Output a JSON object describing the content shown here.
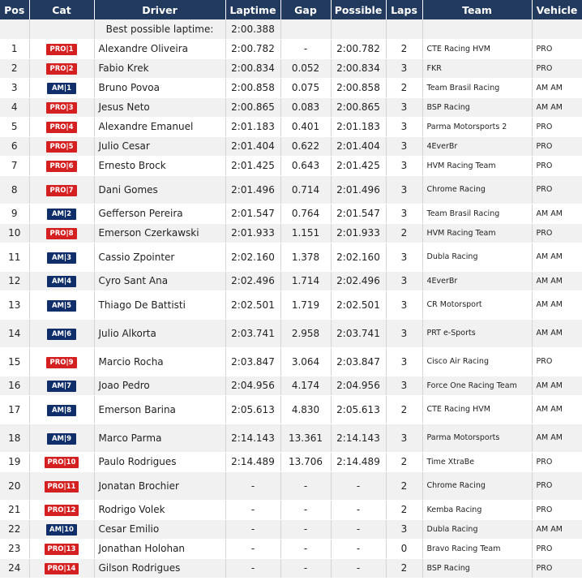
{
  "headers": [
    "Pos",
    "Cat",
    "Driver",
    "Laptime",
    "Gap",
    "Possible",
    "Laps",
    "Team",
    "Vehicle"
  ],
  "best": {
    "label": "Best possible laptime:",
    "value": "2:00.388"
  },
  "rows": [
    {
      "pos": "1",
      "cat": "PRO|1",
      "cls": "pro",
      "driver": "Alexandre Oliveira",
      "lap": "2:00.782",
      "gap": "-",
      "possible": "2:00.782",
      "laps": "2",
      "team": "CTE Racing HVM",
      "vehicle": "PRO"
    },
    {
      "pos": "2",
      "cat": "PRO|2",
      "cls": "pro",
      "driver": "Fabio Krek",
      "lap": "2:00.834",
      "gap": "0.052",
      "possible": "2:00.834",
      "laps": "3",
      "team": "FKR",
      "vehicle": "PRO"
    },
    {
      "pos": "3",
      "cat": "AM|1",
      "cls": "am",
      "driver": "Bruno Povoa",
      "lap": "2:00.858",
      "gap": "0.075",
      "possible": "2:00.858",
      "laps": "2",
      "team": "Team Brasil Racing",
      "vehicle": "AM AM"
    },
    {
      "pos": "4",
      "cat": "PRO|3",
      "cls": "pro",
      "driver": "Jesus Neto",
      "lap": "2:00.865",
      "gap": "0.083",
      "possible": "2:00.865",
      "laps": "3",
      "team": "BSP Racing",
      "vehicle": "AM AM"
    },
    {
      "pos": "5",
      "cat": "PRO|4",
      "cls": "pro",
      "driver": "Alexandre Emanuel",
      "lap": "2:01.183",
      "gap": "0.401",
      "possible": "2:01.183",
      "laps": "3",
      "team": "Parma Motorsports 2",
      "vehicle": "PRO"
    },
    {
      "pos": "6",
      "cat": "PRO|5",
      "cls": "pro",
      "driver": "Julio Cesar",
      "lap": "2:01.404",
      "gap": "0.622",
      "possible": "2:01.404",
      "laps": "3",
      "team": "4EverBr",
      "vehicle": "PRO"
    },
    {
      "pos": "7",
      "cat": "PRO|6",
      "cls": "pro",
      "driver": "Ernesto Brock",
      "lap": "2:01.425",
      "gap": "0.643",
      "possible": "2:01.425",
      "laps": "3",
      "team": "HVM Racing Team",
      "vehicle": "PRO"
    },
    {
      "pos": "8",
      "cat": "PRO|7",
      "cls": "pro",
      "driver": "Dani Gomes",
      "lap": "2:01.496",
      "gap": "0.714",
      "possible": "2:01.496",
      "laps": "3",
      "team": "Chrome Racing",
      "vehicle": "PRO"
    },
    {
      "pos": "9",
      "cat": "AM|2",
      "cls": "am",
      "driver": "Gefferson Pereira",
      "lap": "2:01.547",
      "gap": "0.764",
      "possible": "2:01.547",
      "laps": "3",
      "team": "Team Brasil Racing",
      "vehicle": "AM AM"
    },
    {
      "pos": "10",
      "cat": "PRO|8",
      "cls": "pro",
      "driver": "Emerson Czerkawski",
      "lap": "2:01.933",
      "gap": "1.151",
      "possible": "2:01.933",
      "laps": "2",
      "team": "HVM Racing Team",
      "vehicle": "PRO"
    },
    {
      "pos": "11",
      "cat": "AM|3",
      "cls": "am",
      "driver": "Cassio Zpointer",
      "lap": "2:02.160",
      "gap": "1.378",
      "possible": "2:02.160",
      "laps": "3",
      "team": "Dubla Racing",
      "vehicle": "AM AM"
    },
    {
      "pos": "12",
      "cat": "AM|4",
      "cls": "am",
      "driver": "Cyro Sant Ana",
      "lap": "2:02.496",
      "gap": "1.714",
      "possible": "2:02.496",
      "laps": "3",
      "team": "4EverBr",
      "vehicle": "AM AM"
    },
    {
      "pos": "13",
      "cat": "AM|5",
      "cls": "am",
      "driver": "Thiago De Battisti",
      "lap": "2:02.501",
      "gap": "1.719",
      "possible": "2:02.501",
      "laps": "3",
      "team": "CR Motorsport",
      "vehicle": "AM AM"
    },
    {
      "pos": "14",
      "cat": "AM|6",
      "cls": "am",
      "driver": "Julio Alkorta",
      "lap": "2:03.741",
      "gap": "2.958",
      "possible": "2:03.741",
      "laps": "3",
      "team": "PRT e-Sports",
      "vehicle": "AM AM"
    },
    {
      "pos": "15",
      "cat": "PRO|9",
      "cls": "pro",
      "driver": "Marcio Rocha",
      "lap": "2:03.847",
      "gap": "3.064",
      "possible": "2:03.847",
      "laps": "3",
      "team": "Cisco Air Racing",
      "vehicle": "PRO"
    },
    {
      "pos": "16",
      "cat": "AM|7",
      "cls": "am",
      "driver": "Joao Pedro",
      "lap": "2:04.956",
      "gap": "4.174",
      "possible": "2:04.956",
      "laps": "3",
      "team": "Force One Racing Team",
      "vehicle": "AM AM"
    },
    {
      "pos": "17",
      "cat": "AM|8",
      "cls": "am",
      "driver": "Emerson Barina",
      "lap": "2:05.613",
      "gap": "4.830",
      "possible": "2:05.613",
      "laps": "2",
      "team": "CTE Racing HVM",
      "vehicle": "AM AM"
    },
    {
      "pos": "18",
      "cat": "AM|9",
      "cls": "am",
      "driver": "Marco Parma",
      "lap": "2:14.143",
      "gap": "13.361",
      "possible": "2:14.143",
      "laps": "3",
      "team": "Parma Motorsports",
      "vehicle": "AM AM"
    },
    {
      "pos": "19",
      "cat": "PRO|10",
      "cls": "pro",
      "driver": "Paulo Rodrigues",
      "lap": "2:14.489",
      "gap": "13.706",
      "possible": "2:14.489",
      "laps": "2",
      "team": "Time XtraBe",
      "vehicle": "PRO"
    },
    {
      "pos": "20",
      "cat": "PRO|11",
      "cls": "pro",
      "driver": "Jonatan Brochier",
      "lap": "-",
      "gap": "-",
      "possible": "-",
      "laps": "2",
      "team": "Chrome Racing",
      "vehicle": "PRO"
    },
    {
      "pos": "21",
      "cat": "PRO|12",
      "cls": "pro",
      "driver": "Rodrigo Volek",
      "lap": "-",
      "gap": "-",
      "possible": "-",
      "laps": "2",
      "team": "Kemba Racing",
      "vehicle": "PRO"
    },
    {
      "pos": "22",
      "cat": "AM|10",
      "cls": "am",
      "driver": "Cesar Emilio",
      "lap": "-",
      "gap": "-",
      "possible": "-",
      "laps": "3",
      "team": "Dubla Racing",
      "vehicle": "AM AM"
    },
    {
      "pos": "23",
      "cat": "PRO|13",
      "cls": "pro",
      "driver": "Jonathan Holohan",
      "lap": "-",
      "gap": "-",
      "possible": "-",
      "laps": "0",
      "team": "Bravo Racing Team",
      "vehicle": "PRO"
    },
    {
      "pos": "24",
      "cat": "PRO|14",
      "cls": "pro",
      "driver": "Gilson Rodrigues",
      "lap": "-",
      "gap": "-",
      "possible": "-",
      "laps": "2",
      "team": "BSP Racing",
      "vehicle": "PRO"
    }
  ]
}
